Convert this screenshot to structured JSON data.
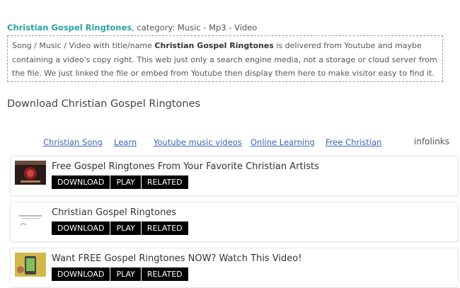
{
  "category_line": {
    "site_name": "Christian Gospel Ringtones",
    "rest": ", category: Music - Mp3 - Video"
  },
  "description": {
    "part1": "Song / Music / Video with title/name ",
    "bold": "Christian Gospel Ringtones",
    "part2": " is delivered from Youtube and maybe containing a video's copy right. This web just only a search engine media, not a storage or cloud server from the file. We just linked the file or embed from Youtube then display them here to make visitor easy to find it."
  },
  "section_heading": "Download Christian Gospel Ringtones",
  "infolinks": {
    "links": [
      "Christian Song",
      "Learn",
      "Youtube music videos",
      "Online Learning",
      "Free Christian"
    ],
    "brand": "infolinks"
  },
  "results": [
    {
      "title": "Free Gospel Ringtones From Your Favorite Christian Artists",
      "buttons": [
        "DOWNLOAD",
        "PLAY",
        "RELATED"
      ]
    },
    {
      "title": "Christian Gospel Ringtones",
      "buttons": [
        "DOWNLOAD",
        "PLAY",
        "RELATED"
      ]
    },
    {
      "title": "Want FREE Gospel Ringtones NOW? Watch This Video!",
      "buttons": [
        "DOWNLOAD",
        "PLAY",
        "RELATED"
      ]
    }
  ],
  "colors": {
    "accent": "#29a2a2",
    "link": "#3a66b8",
    "button_bg": "#000000"
  }
}
